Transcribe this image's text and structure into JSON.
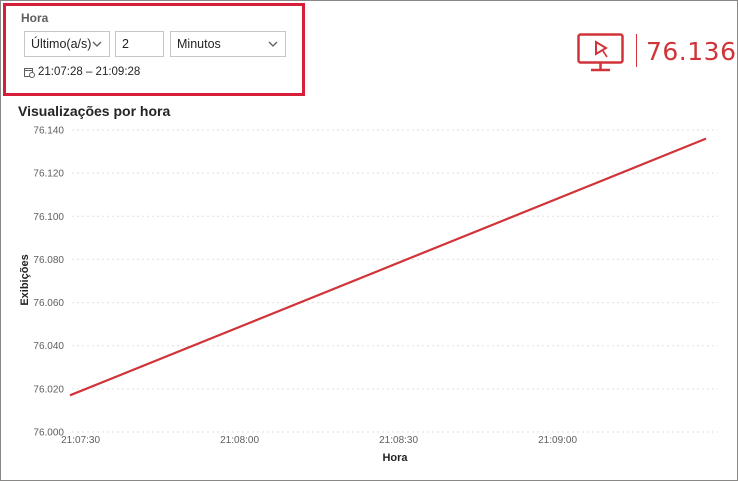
{
  "filter": {
    "title": "Hora",
    "mode": "Último(a/s)",
    "amount": "2",
    "unit": "Minutos",
    "range_text": "21:07:28 – 21:09:28",
    "highlight_color": "#d61f38"
  },
  "kpi": {
    "icon": "monitor-play-icon",
    "value": "76.136",
    "color": "#d13438"
  },
  "chart_data": {
    "type": "line",
    "title": "Visualizações por hora",
    "xlabel": "Hora",
    "ylabel": "Exibições",
    "x_ticks": [
      "21:07:30",
      "21:08:00",
      "21:08:30",
      "21:09:00"
    ],
    "y_ticks": [
      "76.000",
      "76.020",
      "76.040",
      "76.060",
      "76.080",
      "76.100",
      "76.120",
      "76.140"
    ],
    "ylim": [
      76000,
      76140
    ],
    "x_domain_seconds": [
      28,
      148
    ],
    "series": [
      {
        "color": "#d13438",
        "x": [
          28,
          148
        ],
        "y": [
          76017,
          76136
        ]
      }
    ],
    "grid": true
  }
}
